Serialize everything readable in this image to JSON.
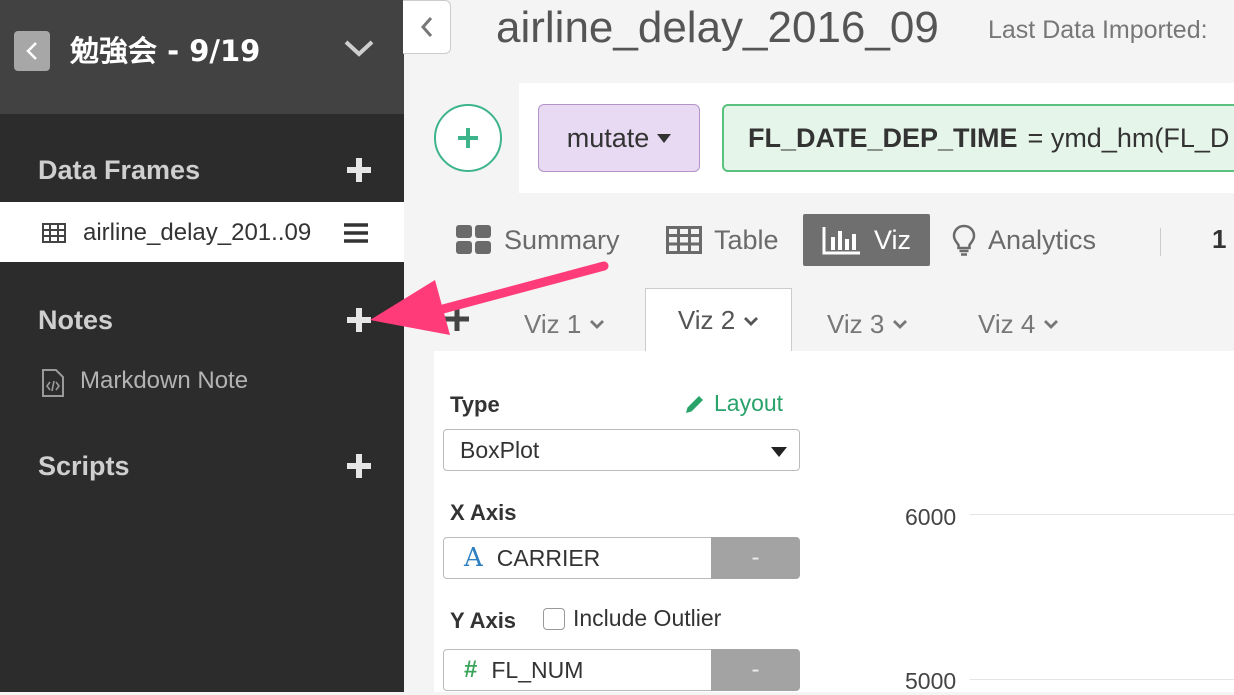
{
  "sidebar": {
    "project_title": "勉強会 - 9/19",
    "data_frames_title": "Data Frames",
    "data_frame_item": "airline_delay_201..09",
    "notes_title": "Notes",
    "note_item": "Markdown Note",
    "scripts_title": "Scripts"
  },
  "header": {
    "title": "airline_delay_2016_09",
    "last_imported": "Last Data Imported:"
  },
  "step": {
    "command": "mutate",
    "expr_bold": "FL_DATE_DEP_TIME",
    "expr_rest": "= ymd_hm(FL_D"
  },
  "view_tabs": [
    "Summary",
    "Table",
    "Viz",
    "Analytics"
  ],
  "active_view_tab": "Viz",
  "row_count_partial": "1",
  "viz_tabs": [
    "Viz 1",
    "Viz 2",
    "Viz 3",
    "Viz 4"
  ],
  "active_viz_tab": "Viz 2",
  "config": {
    "type_label": "Type",
    "layout_link": "Layout",
    "type_value": "BoxPlot",
    "x_axis_label": "X Axis",
    "x_axis_column": "CARRIER",
    "x_axis_type_icon": "A",
    "y_axis_label": "Y Axis",
    "include_outlier": "Include Outlier",
    "y_axis_column": "FL_NUM",
    "y_axis_type_icon": "#",
    "remove_label": "-"
  },
  "chart": {
    "y_ticks": [
      "6000",
      "5000"
    ]
  },
  "annotation": {
    "arrow_color": "#ff3b7a"
  },
  "colors": {
    "accent_green": "#2aa36b",
    "sidebar_bg": "#2c2c2c"
  }
}
